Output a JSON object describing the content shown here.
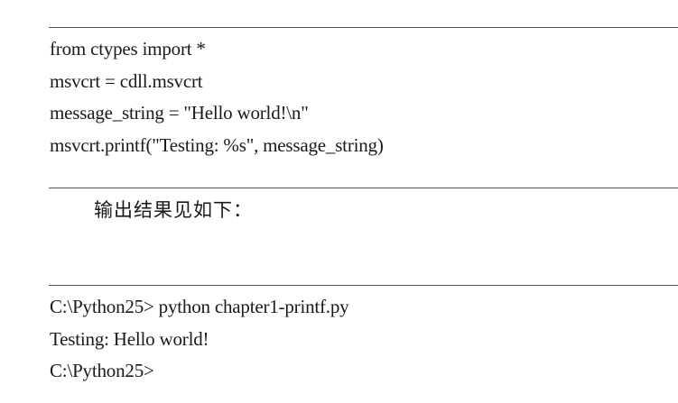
{
  "code_listing": {
    "lines": [
      "from ctypes import *",
      "msvcrt = cdll.msvcrt",
      "message_string = \"Hello world!\\n\"",
      "msvcrt.printf(\"Testing: %s\", message_string)"
    ]
  },
  "body_text": {
    "paragraph": "输出结果见如下："
  },
  "console_output": {
    "lines": [
      "C:\\Python25> python chapter1-printf.py",
      "Testing: Hello world!",
      "C:\\Python25>"
    ]
  }
}
